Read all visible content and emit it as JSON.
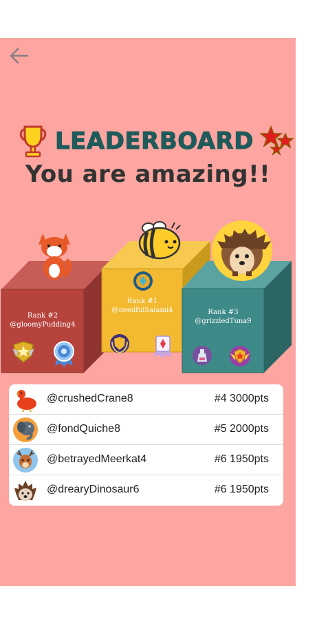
{
  "header": {
    "back_icon": "arrow-left-icon"
  },
  "title": {
    "text": "LEADERBOARD",
    "subtitle": "You are amazing!!"
  },
  "podium": [
    {
      "rank_label": "Rank #2",
      "username": "@gloomyPudding4",
      "mascot": "fox",
      "color": "#b7433d"
    },
    {
      "rank_label": "Rank #1",
      "username": "@needfulSalami4",
      "mascot": "bee",
      "color": "#f3b931"
    },
    {
      "rank_label": "Rank #3",
      "username": "@grizzledTuna9",
      "mascot": "hedgehog",
      "color": "#3e8a88"
    }
  ],
  "leaderboard": [
    {
      "username": "@crushedCrane8",
      "score": "#4 3000pts",
      "avatar": "duck-avatar"
    },
    {
      "username": "@fondQuiche8",
      "score": "#5 2000pts",
      "avatar": "elephant-avatar"
    },
    {
      "username": "@betrayedMeerkat4",
      "score": "#6 1950pts",
      "avatar": "deer-avatar"
    },
    {
      "username": "@drearyDinosaur6",
      "score": "#6 1950pts",
      "avatar": "hedgehog-avatar"
    }
  ],
  "colors": {
    "background": "#fda5a0",
    "title": "#1f5b5a",
    "subtitle": "#333333"
  }
}
